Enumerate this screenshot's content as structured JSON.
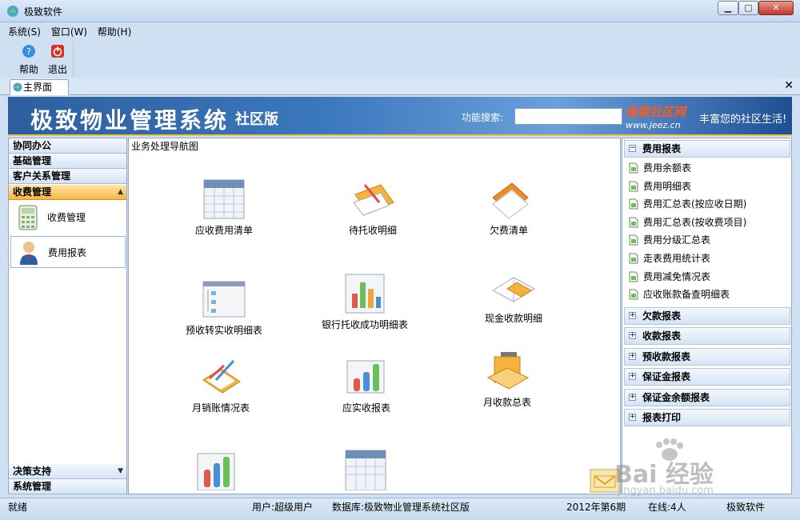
{
  "window": {
    "title": "极致软件"
  },
  "menu": [
    "系统(S)",
    "窗口(W)",
    "帮助(H)"
  ],
  "toolbar": {
    "help": "帮助",
    "exit": "退出"
  },
  "tabs": {
    "main": "主界面"
  },
  "banner": {
    "title": "极致物业管理系统",
    "edition": "社区版",
    "search_label": "功能搜索:",
    "search_value": "",
    "logo_main": "极致社区网",
    "logo_sub": "www.jeez.cn",
    "slogan": "丰富您的社区生活!"
  },
  "left": {
    "groups_top": [
      "协同办公",
      "基础管理",
      "客户关系管理"
    ],
    "active_group": "收费管理",
    "items": [
      "收费管理",
      "费用报表"
    ],
    "groups_bottom": [
      "决策支持",
      "系统管理"
    ]
  },
  "nav": {
    "title": "业务处理导航图",
    "items": [
      "应收费用清单",
      "待托收明细",
      "欠费清单",
      "预收转实收明细表",
      "银行托收成功明细表",
      "现金收款明细",
      "月销账情况表",
      "应实收报表",
      "月收款总表"
    ]
  },
  "right": {
    "expanded": {
      "title": "费用报表",
      "items": [
        "费用余额表",
        "费用明细表",
        "费用汇总表(按应收日期)",
        "费用汇总表(按收费项目)",
        "费用分级汇总表",
        "走表费用统计表",
        "费用减免情况表",
        "应收账款备查明细表"
      ]
    },
    "collapsed": [
      "欠款报表",
      "收款报表",
      "预收款报表",
      "保证金报表",
      "保证金余额报表",
      "报表打印"
    ]
  },
  "status": {
    "ready": "就绪",
    "user": "用户:超级用户",
    "database": "数据库:极致物业管理系统社区版",
    "period": "2012年第6期",
    "online": "在线:4人",
    "brand": "极致软件"
  },
  "watermark": {
    "text": "Bai 经验",
    "sub": "jingyan.baidu.com"
  }
}
